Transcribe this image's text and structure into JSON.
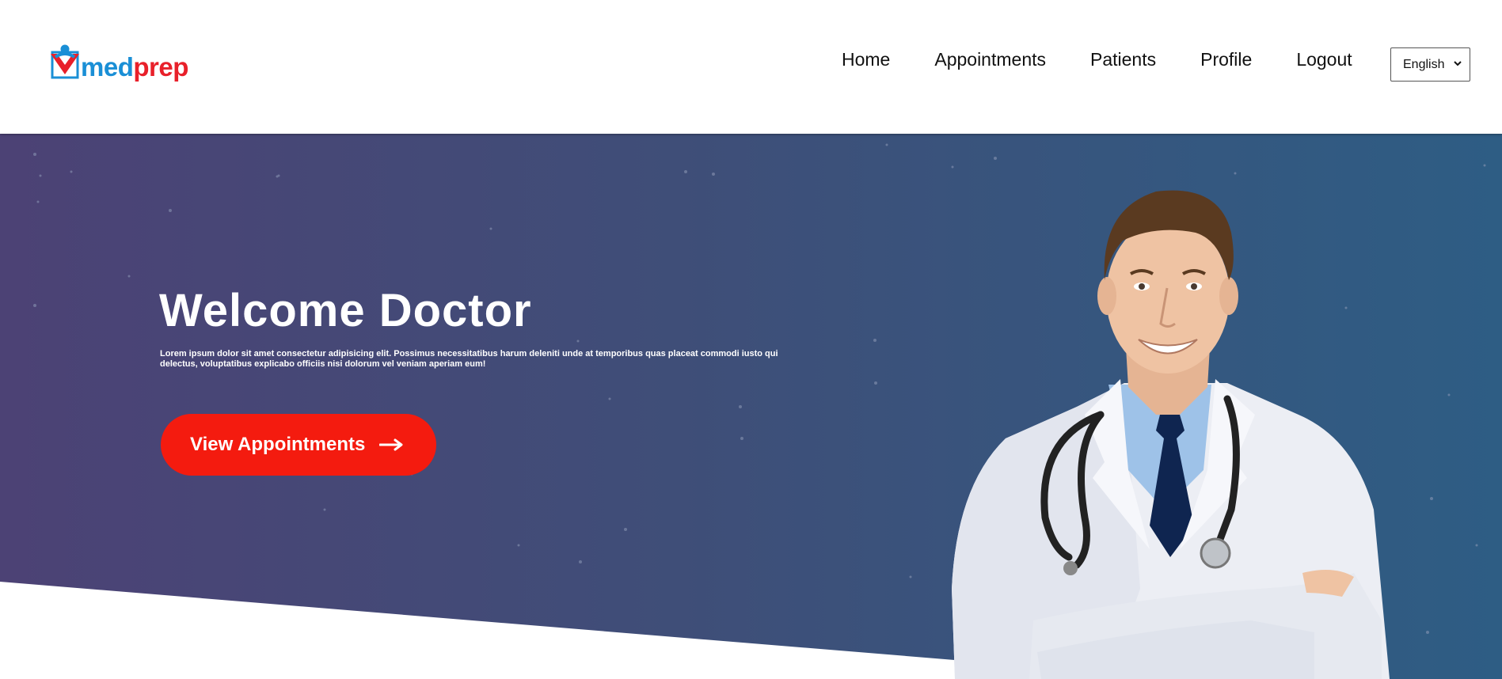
{
  "header": {
    "logo": {
      "med": "med",
      "prep": "prep"
    },
    "nav": [
      {
        "label": "Home"
      },
      {
        "label": "Appointments"
      },
      {
        "label": "Patients"
      },
      {
        "label": "Profile"
      },
      {
        "label": "Logout"
      }
    ],
    "language": {
      "selected": "English",
      "icon": "chevron-down-icon"
    }
  },
  "hero": {
    "title": "Welcome Doctor",
    "text": "Lorem ipsum dolor sit amet consectetur adipisicing elit. Possimus necessitatibus harum deleniti unde at temporibus quas placeat commodi iusto qui delectus, voluptatibus explicabo officiis nisi dolorum vel veniam aperiam eum!",
    "cta_label": "View Appointments",
    "cta_icon": "arrow-right-icon",
    "image": "doctor-photo"
  },
  "colors": {
    "brand_blue": "#1a8fd6",
    "brand_red": "#e8202a",
    "cta": "#f41b0f",
    "hero_gradient_start": "#4c4275",
    "hero_gradient_end": "#2e5d84"
  }
}
